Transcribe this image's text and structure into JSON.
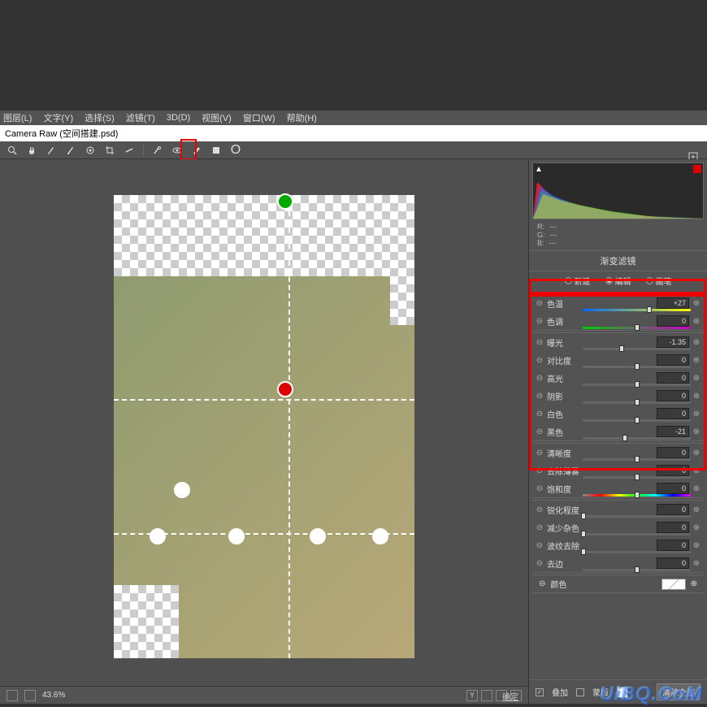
{
  "menu": {
    "layer": "图层(L)",
    "text": "文字(Y)",
    "select": "选择(S)",
    "filter": "滤镜(T)",
    "threeD": "3D(D)",
    "view": "视图(V)",
    "window": "窗口(W)",
    "help": "帮助(H)"
  },
  "title": "Camera Raw (空间搭建.psd)",
  "toolbar": {
    "zoom_readout": "O"
  },
  "footer": {
    "zoom": "43.6%"
  },
  "rgb": {
    "r_label": "R:",
    "g_label": "G:",
    "b_label": "B:",
    "dash": "---"
  },
  "panel": {
    "title": "渐变滤镜",
    "mode_new": "新建",
    "mode_edit": "编辑",
    "mode_brush": "画笔"
  },
  "sliders": {
    "group1": [
      {
        "label": "色温",
        "value": "+27",
        "thumb": 62,
        "track": "color-temp"
      },
      {
        "label": "色调",
        "value": "0",
        "thumb": 50,
        "track": "color-tint"
      }
    ],
    "group2": [
      {
        "label": "曝光",
        "value": "-1.35",
        "thumb": 36
      },
      {
        "label": "对比度",
        "value": "0",
        "thumb": 50
      },
      {
        "label": "高光",
        "value": "0",
        "thumb": 50
      },
      {
        "label": "阴影",
        "value": "0",
        "thumb": 50
      },
      {
        "label": "白色",
        "value": "0",
        "thumb": 50
      },
      {
        "label": "黑色",
        "value": "-21",
        "thumb": 39
      }
    ],
    "group3": [
      {
        "label": "清晰度",
        "value": "0",
        "thumb": 50
      },
      {
        "label": "去除薄雾",
        "value": "0",
        "thumb": 50
      },
      {
        "label": "饱和度",
        "value": "0",
        "thumb": 50,
        "track": "sat"
      }
    ],
    "group4": [
      {
        "label": "锐化程度",
        "value": "0",
        "thumb": 1
      },
      {
        "label": "减少杂色",
        "value": "0",
        "thumb": 1
      },
      {
        "label": "波纹去除",
        "value": "0",
        "thumb": 1
      },
      {
        "label": "去边",
        "value": "0",
        "thumb": 50
      }
    ],
    "color_label": "颜色"
  },
  "bottom": {
    "overlay": "叠加",
    "mask": "蒙版",
    "clear": "清除全部"
  },
  "settings_link": "确定",
  "watermark": "UiBQ.CoM"
}
